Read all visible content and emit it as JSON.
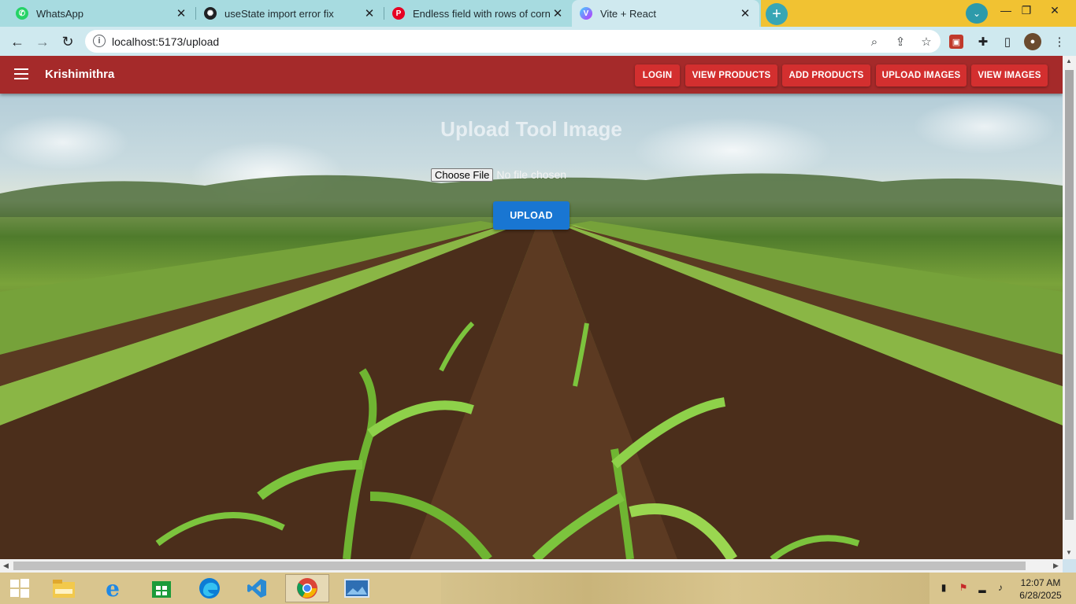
{
  "browser": {
    "tabs": [
      {
        "title": "WhatsApp",
        "icon": "whatsapp-icon",
        "color": "#25d366"
      },
      {
        "title": "useState import error fix",
        "icon": "chatgpt-icon",
        "color": "#202124"
      },
      {
        "title": "Endless field with rows of corn pl",
        "icon": "pinterest-icon",
        "color": "#e60023"
      },
      {
        "title": "Vite + React",
        "icon": "vite-icon",
        "color": "#8f6bff",
        "active": true
      }
    ],
    "url": "localhost:5173/upload"
  },
  "app": {
    "brand": "Krishimithra",
    "nav": {
      "login": "LOGIN",
      "view_products": "VIEW PRODUCTS",
      "add_products": "ADD PRODUCTS",
      "upload_images": "UPLOAD IMAGES",
      "view_images": "VIEW IMAGES"
    },
    "page": {
      "title": "Upload Tool Image",
      "file_button": "Choose File",
      "file_status": "No file chosen",
      "upload_button": "UPLOAD"
    },
    "colors": {
      "navbar": "#a52a2a",
      "nav_button": "#d32f2f",
      "upload_button": "#1976d2"
    }
  },
  "taskbar": {
    "time": "12:07 AM",
    "date": "6/28/2025"
  }
}
